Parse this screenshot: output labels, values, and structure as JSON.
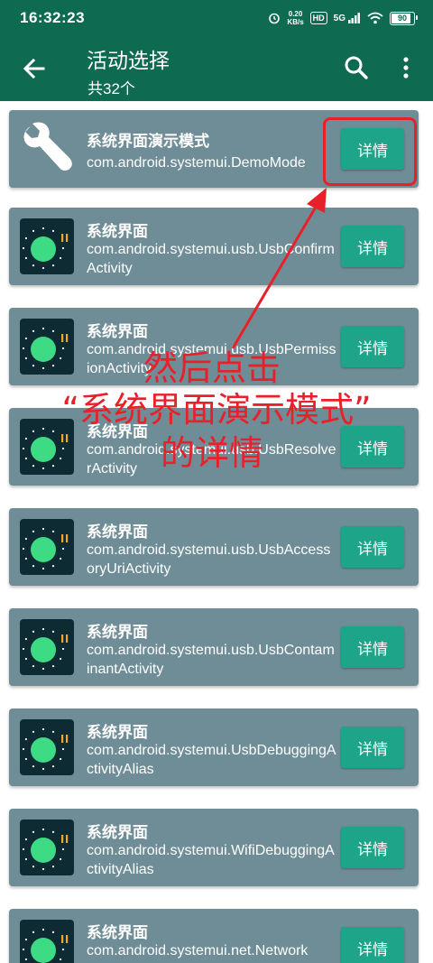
{
  "status_bar": {
    "time": "16:32:23",
    "net_speed_value": "0.20",
    "net_speed_unit": "KB/s",
    "hd_label": "HD",
    "signal_label": "5G",
    "battery_level": "90"
  },
  "app_bar": {
    "title": "活动选择",
    "subtitle": "共32个",
    "back_icon": "arrow-back-icon",
    "search_icon": "search-icon",
    "more_icon": "more-vert-icon"
  },
  "colors": {
    "primary": "#0f6a52",
    "card_bg": "#6f8d97",
    "button_bg": "#1ea488",
    "annotation_red": "#e8202a"
  },
  "activities": [
    {
      "title": "系统界面演示模式",
      "package": "com.android.systemui.DemoMode",
      "button_label": "详情",
      "icon": "wrench-icon"
    },
    {
      "title": "系统界面",
      "package": "com.android.systemui.usb.UsbConfirmActivity",
      "button_label": "详情",
      "icon": "android-11-icon"
    },
    {
      "title": "系统界面",
      "package": "com.android.systemui.usb.UsbPermissionActivity",
      "button_label": "详情",
      "icon": "android-11-icon"
    },
    {
      "title": "系统界面",
      "package": "com.android.systemui.usb.UsbResolverActivity",
      "button_label": "详情",
      "icon": "android-11-icon"
    },
    {
      "title": "系统界面",
      "package": "com.android.systemui.usb.UsbAccessoryUriActivity",
      "button_label": "详情",
      "icon": "android-11-icon"
    },
    {
      "title": "系统界面",
      "package": "com.android.systemui.usb.UsbContaminantActivity",
      "button_label": "详情",
      "icon": "android-11-icon"
    },
    {
      "title": "系统界面",
      "package": "com.android.systemui.UsbDebuggingActivityAlias",
      "button_label": "详情",
      "icon": "android-11-icon"
    },
    {
      "title": "系统界面",
      "package": "com.android.systemui.WifiDebuggingActivityAlias",
      "button_label": "详情",
      "icon": "android-11-icon"
    },
    {
      "title": "系统界面",
      "package": "com.android.systemui.net.Network",
      "button_label": "详情",
      "icon": "android-11-icon"
    }
  ],
  "annotation": {
    "line1": "然后点击",
    "line2": "“系统界面演示模式”",
    "line3": "的详情"
  }
}
